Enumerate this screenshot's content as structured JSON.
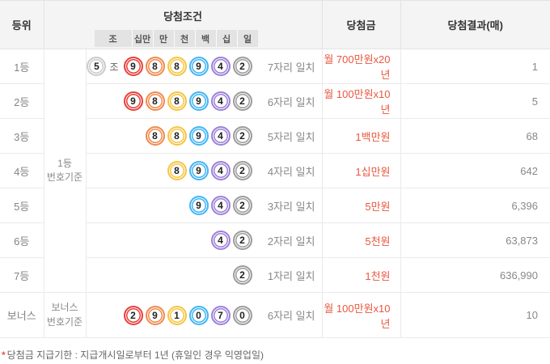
{
  "header": {
    "rank": "등위",
    "condition": "당첨조건",
    "prize": "당첨금",
    "result": "당첨결과(매)"
  },
  "digit_labels": [
    "조",
    "십만",
    "만",
    "천",
    "백",
    "십",
    "일"
  ],
  "group_basis": {
    "first": {
      "line1": "1등",
      "line2": "번호기준"
    },
    "bonus": {
      "line1": "보너스",
      "line2": "번호기준"
    }
  },
  "ball_colors": {
    "silver": "#cbcbcb",
    "red": "#e8413c",
    "orange": "#f08a4e",
    "yellow": "#f5c543",
    "blue": "#41b5f5",
    "purple": "#9d80da",
    "gray": "#9c9c9c"
  },
  "rows": [
    {
      "rank": "1등",
      "balls": [
        {
          "n": "5",
          "color": "silver"
        },
        {
          "label": "조"
        },
        {
          "n": "9",
          "color": "red"
        },
        {
          "n": "8",
          "color": "orange"
        },
        {
          "n": "8",
          "color": "yellow"
        },
        {
          "n": "9",
          "color": "blue"
        },
        {
          "n": "4",
          "color": "purple"
        },
        {
          "n": "2",
          "color": "gray"
        }
      ],
      "match": "7자리 일치",
      "prize": "월 700만원x20년",
      "count": "1"
    },
    {
      "rank": "2등",
      "balls": [
        {
          "n": "9",
          "color": "red"
        },
        {
          "n": "8",
          "color": "orange"
        },
        {
          "n": "8",
          "color": "yellow"
        },
        {
          "n": "9",
          "color": "blue"
        },
        {
          "n": "4",
          "color": "purple"
        },
        {
          "n": "2",
          "color": "gray"
        }
      ],
      "match": "6자리 일치",
      "prize": "월 100만원x10년",
      "count": "5"
    },
    {
      "rank": "3등",
      "balls": [
        {
          "n": "8",
          "color": "orange"
        },
        {
          "n": "8",
          "color": "yellow"
        },
        {
          "n": "9",
          "color": "blue"
        },
        {
          "n": "4",
          "color": "purple"
        },
        {
          "n": "2",
          "color": "gray"
        }
      ],
      "match": "5자리 일치",
      "prize": "1백만원",
      "count": "68"
    },
    {
      "rank": "4등",
      "balls": [
        {
          "n": "8",
          "color": "yellow"
        },
        {
          "n": "9",
          "color": "blue"
        },
        {
          "n": "4",
          "color": "purple"
        },
        {
          "n": "2",
          "color": "gray"
        }
      ],
      "match": "4자리 일치",
      "prize": "1십만원",
      "count": "642"
    },
    {
      "rank": "5등",
      "balls": [
        {
          "n": "9",
          "color": "blue"
        },
        {
          "n": "4",
          "color": "purple"
        },
        {
          "n": "2",
          "color": "gray"
        }
      ],
      "match": "3자리 일치",
      "prize": "5만원",
      "count": "6,396"
    },
    {
      "rank": "6등",
      "balls": [
        {
          "n": "4",
          "color": "purple"
        },
        {
          "n": "2",
          "color": "gray"
        }
      ],
      "match": "2자리 일치",
      "prize": "5천원",
      "count": "63,873"
    },
    {
      "rank": "7등",
      "balls": [
        {
          "n": "2",
          "color": "gray"
        }
      ],
      "match": "1자리 일치",
      "prize": "1천원",
      "count": "636,990"
    },
    {
      "rank": "보너스",
      "balls": [
        {
          "n": "2",
          "color": "red"
        },
        {
          "n": "9",
          "color": "orange"
        },
        {
          "n": "1",
          "color": "yellow"
        },
        {
          "n": "0",
          "color": "blue"
        },
        {
          "n": "7",
          "color": "purple"
        },
        {
          "n": "0",
          "color": "gray"
        }
      ],
      "match": "6자리 일치",
      "prize": "월 100만원x10년",
      "count": "10"
    }
  ],
  "footer": {
    "mark": "*",
    "note": "당첨금 지급기한 : 지급개시일로부터 1년 (휴일인 경우 익영업일)"
  }
}
